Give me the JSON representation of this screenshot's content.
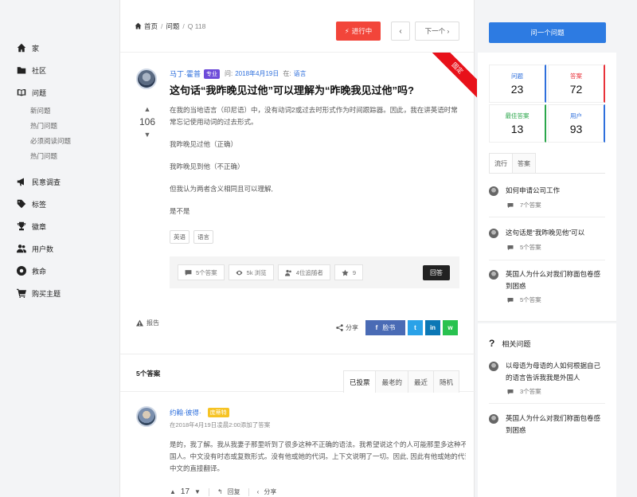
{
  "sidebar": {
    "items": [
      {
        "label": "家",
        "icon": "home-icon"
      },
      {
        "label": "社区",
        "icon": "folder-icon"
      },
      {
        "label": "问题",
        "icon": "book-icon"
      },
      {
        "label": "民意调查",
        "icon": "megaphone-icon"
      },
      {
        "label": "标签",
        "icon": "tag-icon"
      },
      {
        "label": "徽章",
        "icon": "trophy-icon"
      },
      {
        "label": "用户数",
        "icon": "users-icon"
      },
      {
        "label": "救命",
        "icon": "lifebuoy-icon"
      },
      {
        "label": "购买主题",
        "icon": "cart-icon"
      }
    ],
    "subitems": [
      "新问题",
      "热门问题",
      "必须阅读问题",
      "热门问题"
    ]
  },
  "breadcrumb": {
    "home": "首页",
    "questions": "问题",
    "current": "Q 118"
  },
  "topbar": {
    "status": "进行中",
    "prev": "‹",
    "next": "下一个 ›"
  },
  "question": {
    "ribbon": "固定",
    "author": "马丁·霍普",
    "badge": "专业",
    "asked_label": "问:",
    "date": "2018年4月19日",
    "in_label": "在:",
    "category": "语言",
    "title": "这句话“我昨晚见过他”可以理解为“昨晚我见过他”吗?",
    "votes": "106",
    "body": [
      "在我的当地语言（印尼语）中，没有动词2或过去时形式作为时间跟踪器。因此，我在讲英语时常常忘记使用动词的过去形式。",
      "我昨晚见过他（正确）",
      "我昨晚见到他（不正确）",
      "但我认为两者含义相同且可以理解,",
      "是不是"
    ],
    "tags": [
      "英语",
      "语言"
    ],
    "stats": {
      "answers": "5个答案",
      "views": "5k 浏览",
      "followers": "4位追随者",
      "favorites": "9"
    },
    "answer_button": "回答",
    "report": "报告",
    "share_label": "分享",
    "share_fb": "脸书",
    "share_tw": "t",
    "share_in": "in",
    "share_wa": "w"
  },
  "answers": {
    "count_label": "5个答案",
    "tabs": [
      "已投票",
      "最老的",
      "最近",
      "随机"
    ],
    "first": {
      "author": "约翰·彼得·",
      "badge": "庞蒂特",
      "time": "在2018年4月19日凌晨2:00添加了答案",
      "body": [
        "是的，我了解。我从我妻子那里听到了很多这种不正确的语法。我希望说这个的人可能那里多这种不正确的语法。",
        "国人。中文没有时态或复数形式。没有他或她的代词。上下文说明了一切。因此, 因此有他或她的代词。上下文说明有他说这个的人",
        "中文的直接翻译。"
      ],
      "votes": "17",
      "reply": "回复",
      "share": "分享"
    }
  },
  "right": {
    "ask_button": "问一个问题",
    "stats": [
      {
        "label": "问题",
        "value": "23"
      },
      {
        "label": "答案",
        "value": "72"
      },
      {
        "label": "最佳答案",
        "value": "13"
      },
      {
        "label": "用户",
        "value": "93"
      }
    ],
    "tabs": [
      "流行",
      "答案"
    ],
    "popular": [
      {
        "title": "如何申请公司工作",
        "count": "7个答案"
      },
      {
        "title": "这句话是“我昨晚见他”可以",
        "count": "5个答案"
      },
      {
        "title": "英国人为什么对我们称面包卷感到困惑",
        "count": "5个答案"
      }
    ],
    "related_title": "相关问题",
    "related": [
      {
        "title": "以母语为母语的人如何根据自己的语言告诉我我是外国人",
        "count": "3个答案"
      },
      {
        "title": "英国人为什么对我们称面包卷感到困惑",
        "count": ""
      }
    ]
  },
  "colors": {
    "accent": "#2d7be2",
    "status": "#f2453a",
    "ribbon": "#e8111a",
    "pro_badge": "#6d4bd9",
    "top_badge": "#f6c324"
  }
}
